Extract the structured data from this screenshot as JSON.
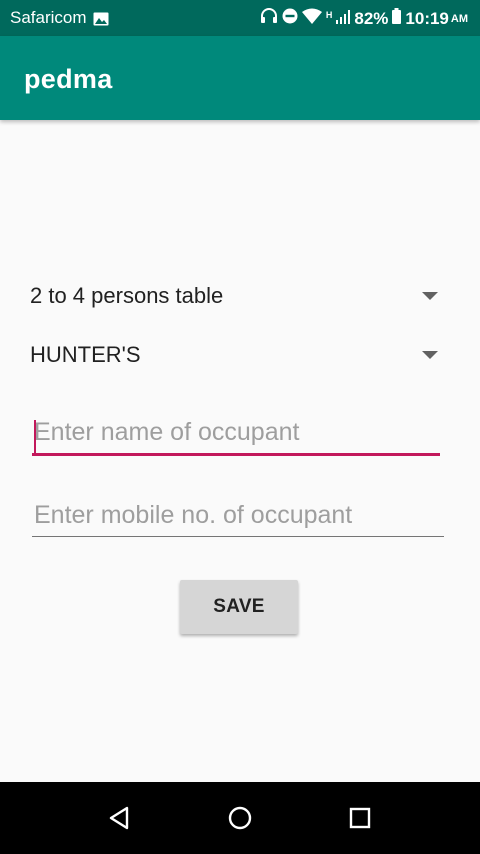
{
  "status_bar": {
    "carrier": "Safaricom",
    "battery": "82%",
    "time": "10:19",
    "ampm": "AM",
    "network_type": "H",
    "icons": [
      "image-icon",
      "headphones-icon",
      "do-not-disturb-icon",
      "wifi-icon",
      "signal-icon",
      "battery-icon"
    ]
  },
  "app_bar": {
    "title": "pedma",
    "color": "#00897b"
  },
  "form": {
    "table_spinner": {
      "selected": "2 to 4 persons table"
    },
    "venue_spinner": {
      "selected": "HUNTER'S"
    },
    "name_field": {
      "value": "",
      "placeholder": "Enter name of occupant"
    },
    "mobile_field": {
      "value": "",
      "placeholder": "Enter mobile no. of occupant"
    },
    "save_label": "SAVE",
    "accent_color": "#c2185b"
  },
  "nav_bar": {
    "icons": [
      "back-icon",
      "home-icon",
      "recents-icon"
    ]
  }
}
